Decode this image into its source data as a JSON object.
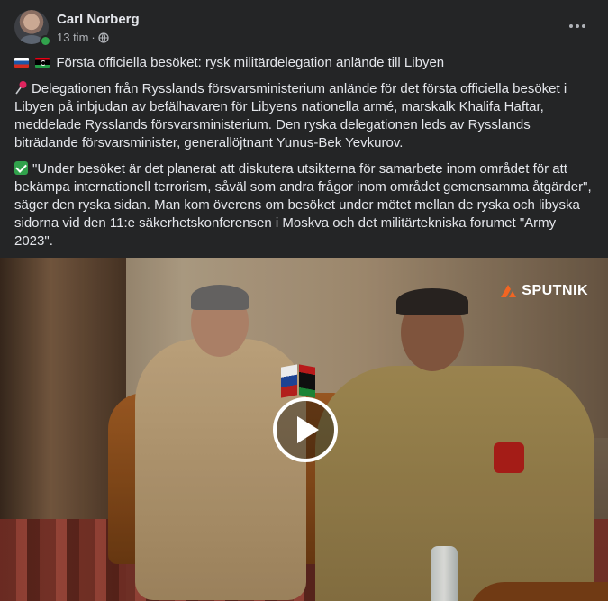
{
  "post": {
    "author": "Carl Norberg",
    "time": "13 tim",
    "separator": "·",
    "privacy_icon": "globe-icon",
    "more_icon": "more-options-icon",
    "headline": "Första officiella besöket: rysk militärdelegation anlände till Libyen",
    "paragraph1": "Delegationen från Rysslands försvarsministerium anlände för det första officiella besöket i Libyen på inbjudan av befälhavaren för Libyens nationella armé, marskalk Khalifa Haftar, meddelade Rysslands försvarsministerium. Den ryska delegationen leds av Rysslands biträdande försvarsminister, generallöjtnant Yunus-Bek Yevkurov.",
    "paragraph2": "\"Under besöket är det planerat att diskutera utsikterna för samarbete inom området för att bekämpa internationell terrorism, såväl som andra frågor inom området gemensamma åtgärder\", säger den ryska sidan. Man kom överens om besöket under mötet mellan de ryska och libyska sidorna vid den 11:e säkerhetskonferensen i Moskva och det militärtekniska forumet \"Army 2023\"."
  },
  "video": {
    "watermark": "SPUTNIK",
    "play_icon": "play-icon"
  },
  "colors": {
    "background": "#242526",
    "text": "#e4e6eb",
    "secondary_text": "#b0b3b8",
    "online": "#31a24c"
  }
}
